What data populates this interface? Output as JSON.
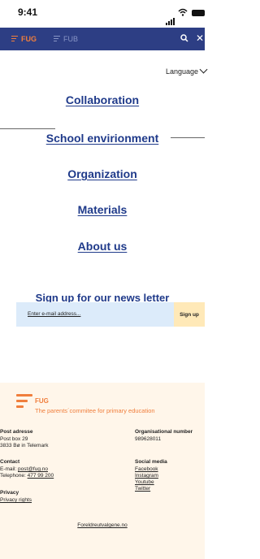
{
  "status_bar": {
    "time": "9:41"
  },
  "nav": {
    "items": [
      {
        "label": "FUG"
      },
      {
        "label": "FUB"
      }
    ],
    "close_glyph": "✕"
  },
  "language": {
    "label": "Language"
  },
  "menu": [
    {
      "label": "Collaboration"
    },
    {
      "label": "School envirionment"
    },
    {
      "label": "Organization"
    },
    {
      "label": "Materials"
    },
    {
      "label": "About us"
    }
  ],
  "newsletter": {
    "title": "Sign up for our news letter",
    "placeholder": "Enter e-mail address...",
    "button": "Sign up"
  },
  "footer": {
    "org_name": "FUG",
    "tagline": "The parents´commitee for primary education",
    "post": {
      "heading": "Post adresse",
      "line1": "Post box 29",
      "line2": "3833 Bø in Telemark"
    },
    "org_number": {
      "heading": "Organisational number",
      "value": "989628011"
    },
    "contact": {
      "heading": "Contact",
      "email_label": "E-mail: ",
      "email": "post@fug.no",
      "phone_label": "Telephone: ",
      "phone": "477 99 200"
    },
    "social": {
      "heading": "Social media",
      "links": [
        "Facebook",
        "Instagram",
        "Youtube",
        "Twitter"
      ]
    },
    "privacy": {
      "heading": "Privacy",
      "link": "Privacy rights"
    },
    "site_link": "Foreldreutvalgene.no"
  },
  "colors": {
    "nav_bg": "#2d3e84",
    "accent": "#f07e3c",
    "link": "#1f3a8a",
    "footer_bg": "#fff6ea",
    "input_bg": "#dcebfa",
    "button_bg": "#ffe9b8"
  }
}
